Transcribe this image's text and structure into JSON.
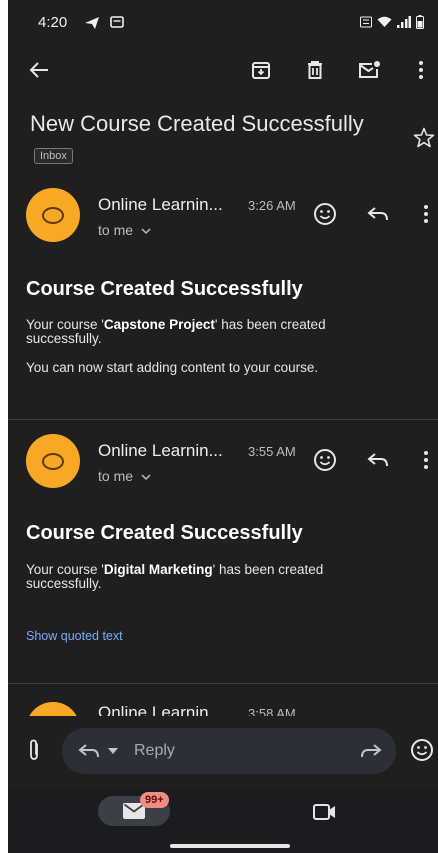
{
  "status_bar": {
    "time": "4:20"
  },
  "toolbar": {
    "back": "back-arrow-icon",
    "archive": "archive-icon",
    "delete": "trash-icon",
    "mark_unread": "mark-unread-icon",
    "more": "more-vert-icon"
  },
  "email": {
    "subject": "New Course Created Successfully",
    "label": "Inbox"
  },
  "messages": [
    {
      "sender": "Online Learnin...",
      "time": "3:26 AM",
      "to": "to me",
      "heading": "Course Created Successfully",
      "body_pre": "Your course '",
      "course": "Capstone Project",
      "body_post": "' has been created successfully.",
      "extra": "You can now start adding content to your course."
    },
    {
      "sender": "Online Learnin...",
      "time": "3:55 AM",
      "to": "to me",
      "heading": "Course Created Successfully",
      "body_pre": "Your course '",
      "course": "Digital Marketing",
      "body_post": "' has been created successfully.",
      "show_quoted": "Show quoted text"
    },
    {
      "sender": "Online Learnin...",
      "time": "3:58 AM"
    }
  ],
  "reply": {
    "label": "Reply"
  },
  "bottom_nav": {
    "mail_badge": "99+"
  },
  "colors": {
    "background": "#1f1f1f",
    "avatar": "#f9a825",
    "link": "#7cacf8",
    "badge": "#f28b82"
  }
}
